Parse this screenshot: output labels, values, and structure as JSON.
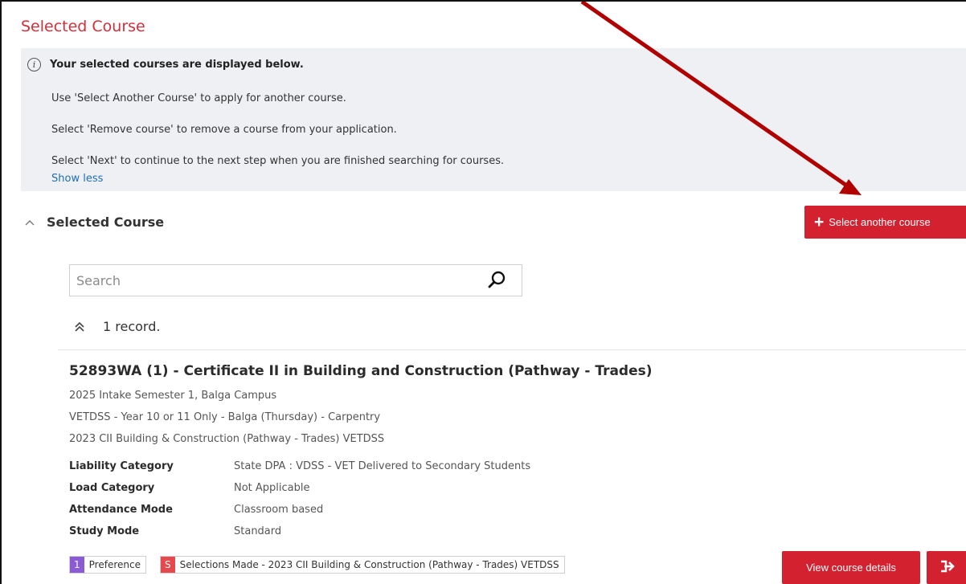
{
  "page": {
    "title": "Selected Course"
  },
  "info": {
    "heading": "Your selected courses are displayed below.",
    "lines": [
      "Use 'Select Another Course' to apply for another course.",
      "Select 'Remove course' to remove a course from your application.",
      "Select 'Next' to continue to the next step when you are finished searching for courses."
    ],
    "toggle_label": "Show less"
  },
  "section": {
    "title": "Selected Course",
    "select_button_label": "Select another course"
  },
  "search": {
    "placeholder": "Search",
    "value": ""
  },
  "records": {
    "label": "1 record."
  },
  "course": {
    "title": "52893WA (1) - Certificate II in Building and Construction (Pathway - Trades)",
    "meta": [
      "2025 Intake Semester 1, Balga Campus",
      "VETDSS - Year 10 or 11 Only - Balga (Thursday) - Carpentry",
      "2023 CII Building & Construction (Pathway - Trades) VETDSS"
    ],
    "details": [
      {
        "label": "Liability Category",
        "value": "State DPA : VDSS - VET Delivered to Secondary Students"
      },
      {
        "label": "Load Category",
        "value": "Not Applicable"
      },
      {
        "label": "Attendance Mode",
        "value": "Classroom based"
      },
      {
        "label": "Study Mode",
        "value": "Standard"
      }
    ],
    "badges": [
      {
        "key": "1",
        "text": "Preference",
        "color": "#8a5bd4"
      },
      {
        "key": "S",
        "text": "Selections Made - 2023 CII Building & Construction (Pathway - Trades) VETDSS",
        "color": "#e5484d"
      }
    ],
    "view_button_label": "View course details"
  },
  "colors": {
    "accent": "#d42130",
    "title": "#d32f3a",
    "link": "#1f6fb5",
    "arrow": "#b00000",
    "info_bg": "#eef0f3"
  },
  "icons": {
    "info": "info-icon",
    "section_toggle": "chevron-up-icon",
    "search": "search-icon",
    "records_toggle": "double-chevron-up-icon",
    "add": "plus-icon",
    "next": "next-step-icon",
    "annotation": "annotation-arrow"
  }
}
